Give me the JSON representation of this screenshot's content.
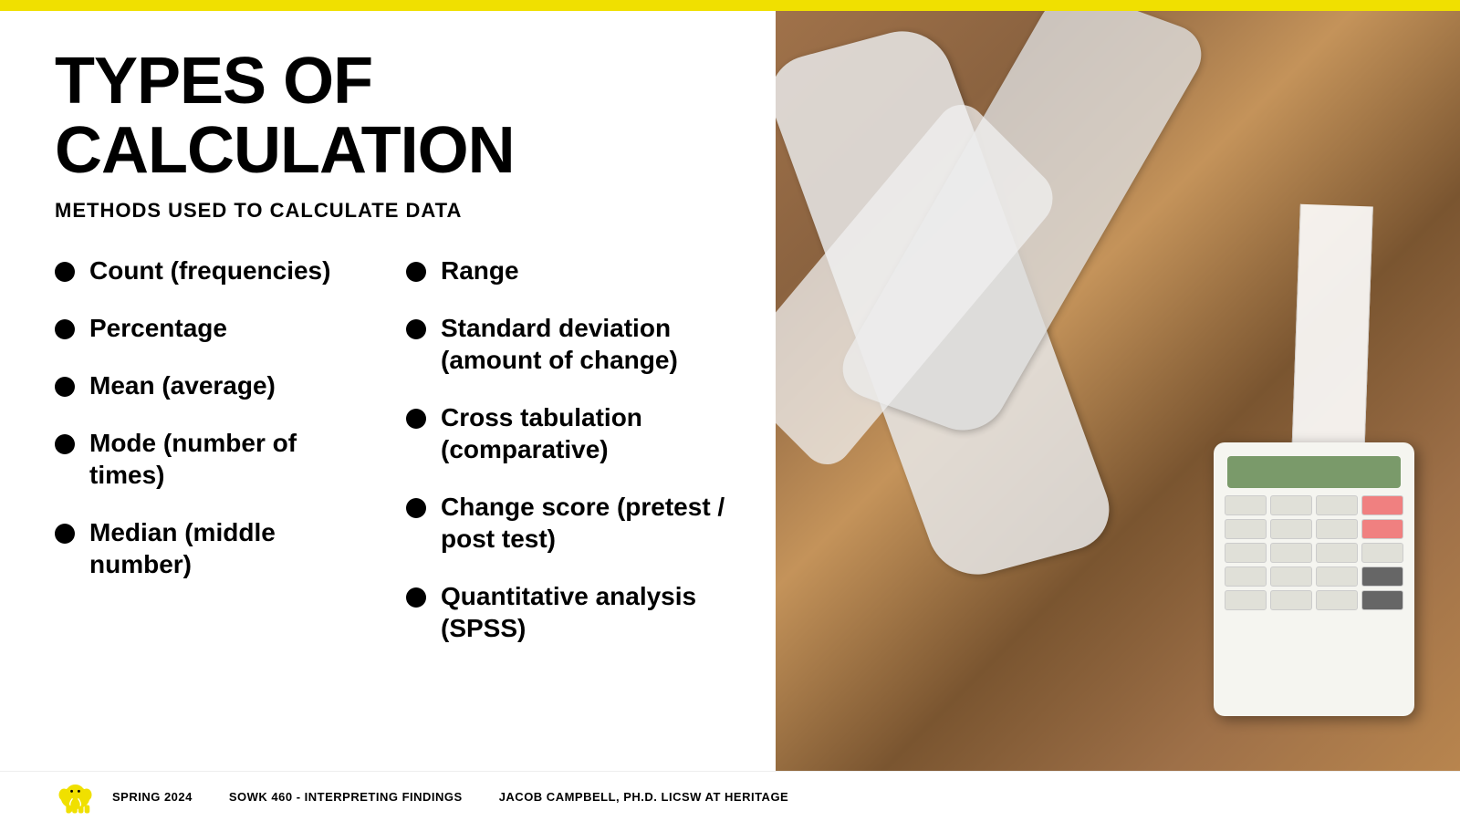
{
  "topBar": {
    "color": "#f0e000"
  },
  "heading": {
    "line1": "TYPES OF",
    "line2": "CALCULATION"
  },
  "subtitle": "METHODS USED TO CALCULATE DATA",
  "leftColumn": {
    "items": [
      {
        "text": "Count (frequencies)"
      },
      {
        "text": "Percentage"
      },
      {
        "text": "Mean (average)"
      },
      {
        "text": "Mode (number of times)"
      },
      {
        "text": "Median (middle number)"
      }
    ]
  },
  "rightColumn": {
    "items": [
      {
        "text": "Range"
      },
      {
        "text": "Standard deviation (amount of change)"
      },
      {
        "text": "Cross tabulation (comparative)"
      },
      {
        "text": "Change score (pretest / post test)"
      },
      {
        "text": "Quantitative analysis (SPSS)"
      }
    ]
  },
  "footer": {
    "semester": "SPRING 2024",
    "course": "SOWK 460 - INTERPRETING FINDINGS",
    "instructor": "JACOB CAMPBELL, PH.D. LICSW AT HERITAGE"
  }
}
